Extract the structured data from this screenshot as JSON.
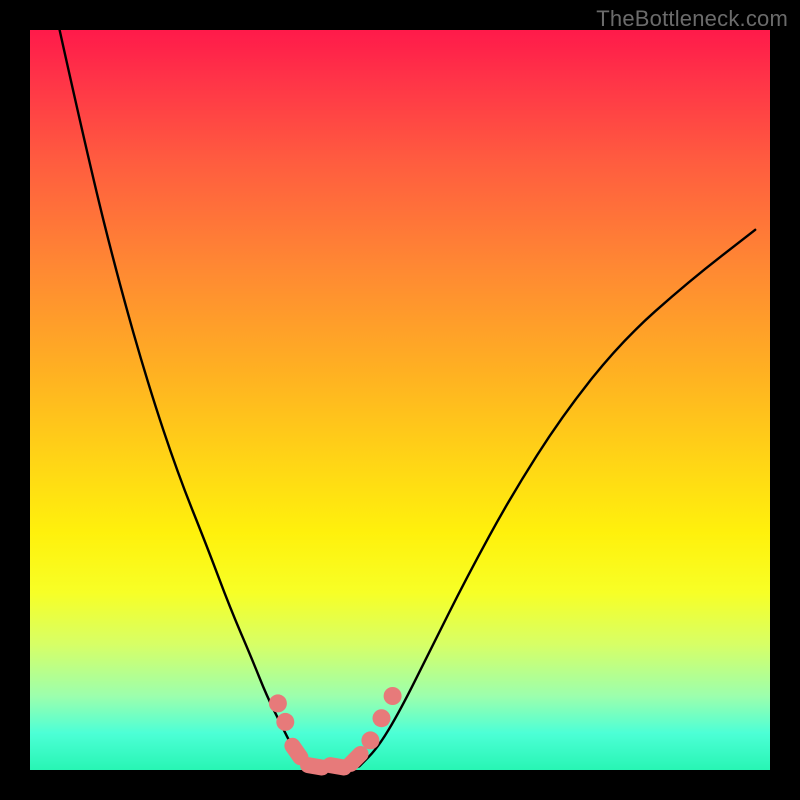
{
  "watermark": "TheBottleneck.com",
  "colors": {
    "background": "#000000",
    "gradient_top": "#ff1a4a",
    "gradient_bottom": "#28f5b4",
    "curve": "#000000",
    "beads": "#e77a7a"
  },
  "chart_data": {
    "type": "line",
    "title": "",
    "xlabel": "",
    "ylabel": "",
    "xlim": [
      0,
      100
    ],
    "ylim": [
      0,
      100
    ],
    "grid": false,
    "legend_position": "none",
    "annotations": [
      "TheBottleneck.com"
    ],
    "series": [
      {
        "name": "left-branch",
        "x": [
          4,
          8,
          12,
          16,
          20,
          24,
          27,
          30,
          32,
          34,
          35.5,
          37
        ],
        "y": [
          100,
          82,
          66,
          52,
          40,
          30,
          22,
          15,
          10,
          6,
          3,
          0.5
        ]
      },
      {
        "name": "valley-floor",
        "x": [
          37,
          39,
          41,
          43,
          44.5
        ],
        "y": [
          0.5,
          0,
          0,
          0,
          0.5
        ]
      },
      {
        "name": "right-branch",
        "x": [
          44.5,
          47,
          50,
          54,
          59,
          65,
          72,
          80,
          89,
          98
        ],
        "y": [
          0.5,
          3,
          8,
          16,
          26,
          37,
          48,
          58,
          66,
          73
        ]
      }
    ],
    "markers": {
      "name": "pink-beads",
      "points": [
        {
          "x": 33.5,
          "y": 9
        },
        {
          "x": 34.5,
          "y": 6.5
        },
        {
          "x": 36,
          "y": 2.5,
          "elongated": true
        },
        {
          "x": 38.5,
          "y": 0.5,
          "elongated": true
        },
        {
          "x": 41.5,
          "y": 0.5,
          "elongated": true
        },
        {
          "x": 44,
          "y": 1.5,
          "elongated": true
        },
        {
          "x": 46,
          "y": 4
        },
        {
          "x": 47.5,
          "y": 7
        },
        {
          "x": 49,
          "y": 10
        }
      ]
    }
  }
}
